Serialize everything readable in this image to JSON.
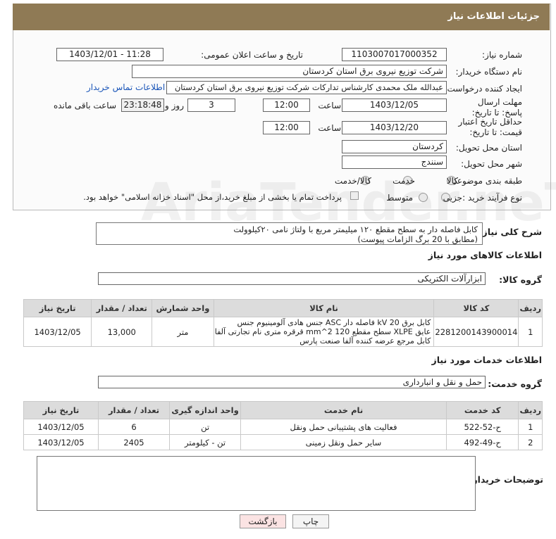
{
  "header": {
    "title": "جزئیات اطلاعات نیاز"
  },
  "fields": {
    "need_number_label": "شماره نیاز:",
    "need_number": "1103007017000352",
    "announce_label": "تاریخ و ساعت اعلان عمومی:",
    "announce_value": "1403/12/01 - 11:28",
    "buyer_org_label": "نام دستگاه خریدار:",
    "buyer_org": "شرکت توزیع نیروی برق استان کردستان",
    "creator_label": "ایجاد کننده درخواست:",
    "creator": "عبدالله ملک محمدی کارشناس تدارکات شرکت توزیع نیروی برق استان کردستان",
    "contact_link": "اطلاعات تماس خریدار",
    "reply_deadline_label": "مهلت ارسال پاسخ: تا تاریخ:",
    "reply_date": "1403/12/05",
    "time_label": "ساعت",
    "reply_time": "12:00",
    "days_value": "3",
    "days_label": "روز و",
    "remaining_time": "23:18:48",
    "remaining_label": "ساعت باقی مانده",
    "price_validity_label": "حداقل تاریخ اعتبار قیمت: تا تاریخ:",
    "price_date": "1403/12/20",
    "price_time": "12:00",
    "province_label": "استان محل تحویل:",
    "province": "کردستان",
    "city_label": "شهر محل تحویل:",
    "city": "سنندج",
    "category_label": "طبقه بندی موضوعی:",
    "category_options": [
      "کالا",
      "خدمت",
      "کالا/خدمت"
    ],
    "process_label": "نوع فرآیند خرید :",
    "process_options": [
      "جزیی",
      "متوسط"
    ],
    "payment_note": "پرداخت تمام یا بخشی از مبلغ خرید،از محل \"اسناد خزانه اسلامی\" خواهد بود."
  },
  "description": {
    "label": "شرح کلی نیاز:",
    "text_line1": "کابل فاصله دار به سطح مقطع ۱۲۰ میلیمتر مربع با ولتاژ نامی ۲۰کیلوولت",
    "text_line2": "(مطابق با 20 برگ الزامات پیوست)"
  },
  "goods": {
    "section_title": "اطلاعات کالاهای مورد نیاز",
    "group_label": "گروه کالا:",
    "group_value": "ابزارآلات الکتریکی",
    "columns": [
      "ردیف",
      "کد کالا",
      "نام کالا",
      "واحد شمارش",
      "تعداد / مقدار",
      "تاریخ نیاز"
    ],
    "rows": [
      {
        "row": "1",
        "code": "2281200143900014",
        "name_l1": "کابل برق kV 20 فاصله دار ASC جنس هادی آلومینیوم جنس",
        "name_l2": "عایق XLPE سطح مقطع mm^2 120 قرقره متری نام تجارتی آلفا",
        "name_l3": "کابل مرجع عرضه کننده آلفا صنعت پارس",
        "unit": "متر",
        "qty": "13,000",
        "date": "1403/12/05"
      }
    ]
  },
  "services": {
    "section_title": "اطلاعات خدمات مورد نیاز",
    "group_label": "گروه خدمت:",
    "group_value": "حمل و نقل و انبارداری",
    "columns": [
      "ردیف",
      "کد خدمت",
      "نام خدمت",
      "واحد اندازه گیری",
      "تعداد / مقدار",
      "تاریخ نیاز"
    ],
    "rows": [
      {
        "row": "1",
        "code": "ح-52-522",
        "name": "فعالیت های پشتیبانی حمل ونقل",
        "unit": "تن",
        "qty": "6",
        "date": "1403/12/05"
      },
      {
        "row": "2",
        "code": "ح-49-492",
        "name": "سایر حمل ونقل زمینی",
        "unit": "تن - کیلومتر",
        "qty": "2405",
        "date": "1403/12/05"
      }
    ]
  },
  "buyer_notes": {
    "label": "توضیحات خریدار:",
    "value": ""
  },
  "buttons": {
    "print": "چاپ",
    "back": "بازگشت"
  },
  "watermark": "AriaTender.neT",
  "colors": {
    "header_bg": "#8f7a55",
    "link": "#1a55b8",
    "table_header": "#dcdcdc",
    "back_button": "#fbe3e3"
  }
}
